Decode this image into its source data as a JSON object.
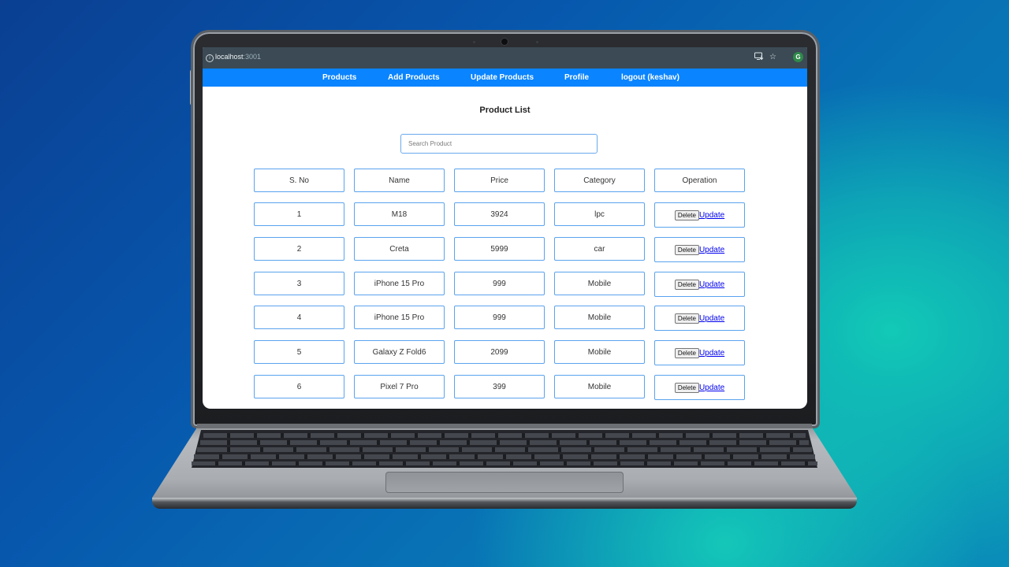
{
  "browser": {
    "url_host": "localhost",
    "url_port": ":3001",
    "icons": [
      "info-icon",
      "install-app-icon",
      "bookmark-star-icon",
      "extension-g-icon"
    ],
    "extension_letter": "G"
  },
  "nav": {
    "items": [
      {
        "label": "Products"
      },
      {
        "label": "Add Products"
      },
      {
        "label": "Update Products"
      },
      {
        "label": "Profile"
      },
      {
        "label": "logout (keshav)"
      }
    ],
    "color": "#0a84ff"
  },
  "main": {
    "title": "Product List",
    "search_placeholder": "Search Product",
    "columns": [
      "S. No",
      "Name",
      "Price",
      "Category",
      "Operation"
    ],
    "rows": [
      {
        "sno": "1",
        "name": "M18",
        "price": "3924",
        "category": "lpc"
      },
      {
        "sno": "2",
        "name": "Creta",
        "price": "5999",
        "category": "car"
      },
      {
        "sno": "3",
        "name": "iPhone 15 Pro",
        "price": "999",
        "category": "Mobile"
      },
      {
        "sno": "4",
        "name": "iPhone 15 Pro",
        "price": "999",
        "category": "Mobile"
      },
      {
        "sno": "5",
        "name": "Galaxy Z Fold6",
        "price": "2099",
        "category": "Mobile"
      },
      {
        "sno": "6",
        "name": "Pixel 7 Pro",
        "price": "399",
        "category": "Mobile"
      }
    ],
    "delete_label": "Delete",
    "update_label": "Update",
    "cell_border_color": "#5aa3ee"
  }
}
